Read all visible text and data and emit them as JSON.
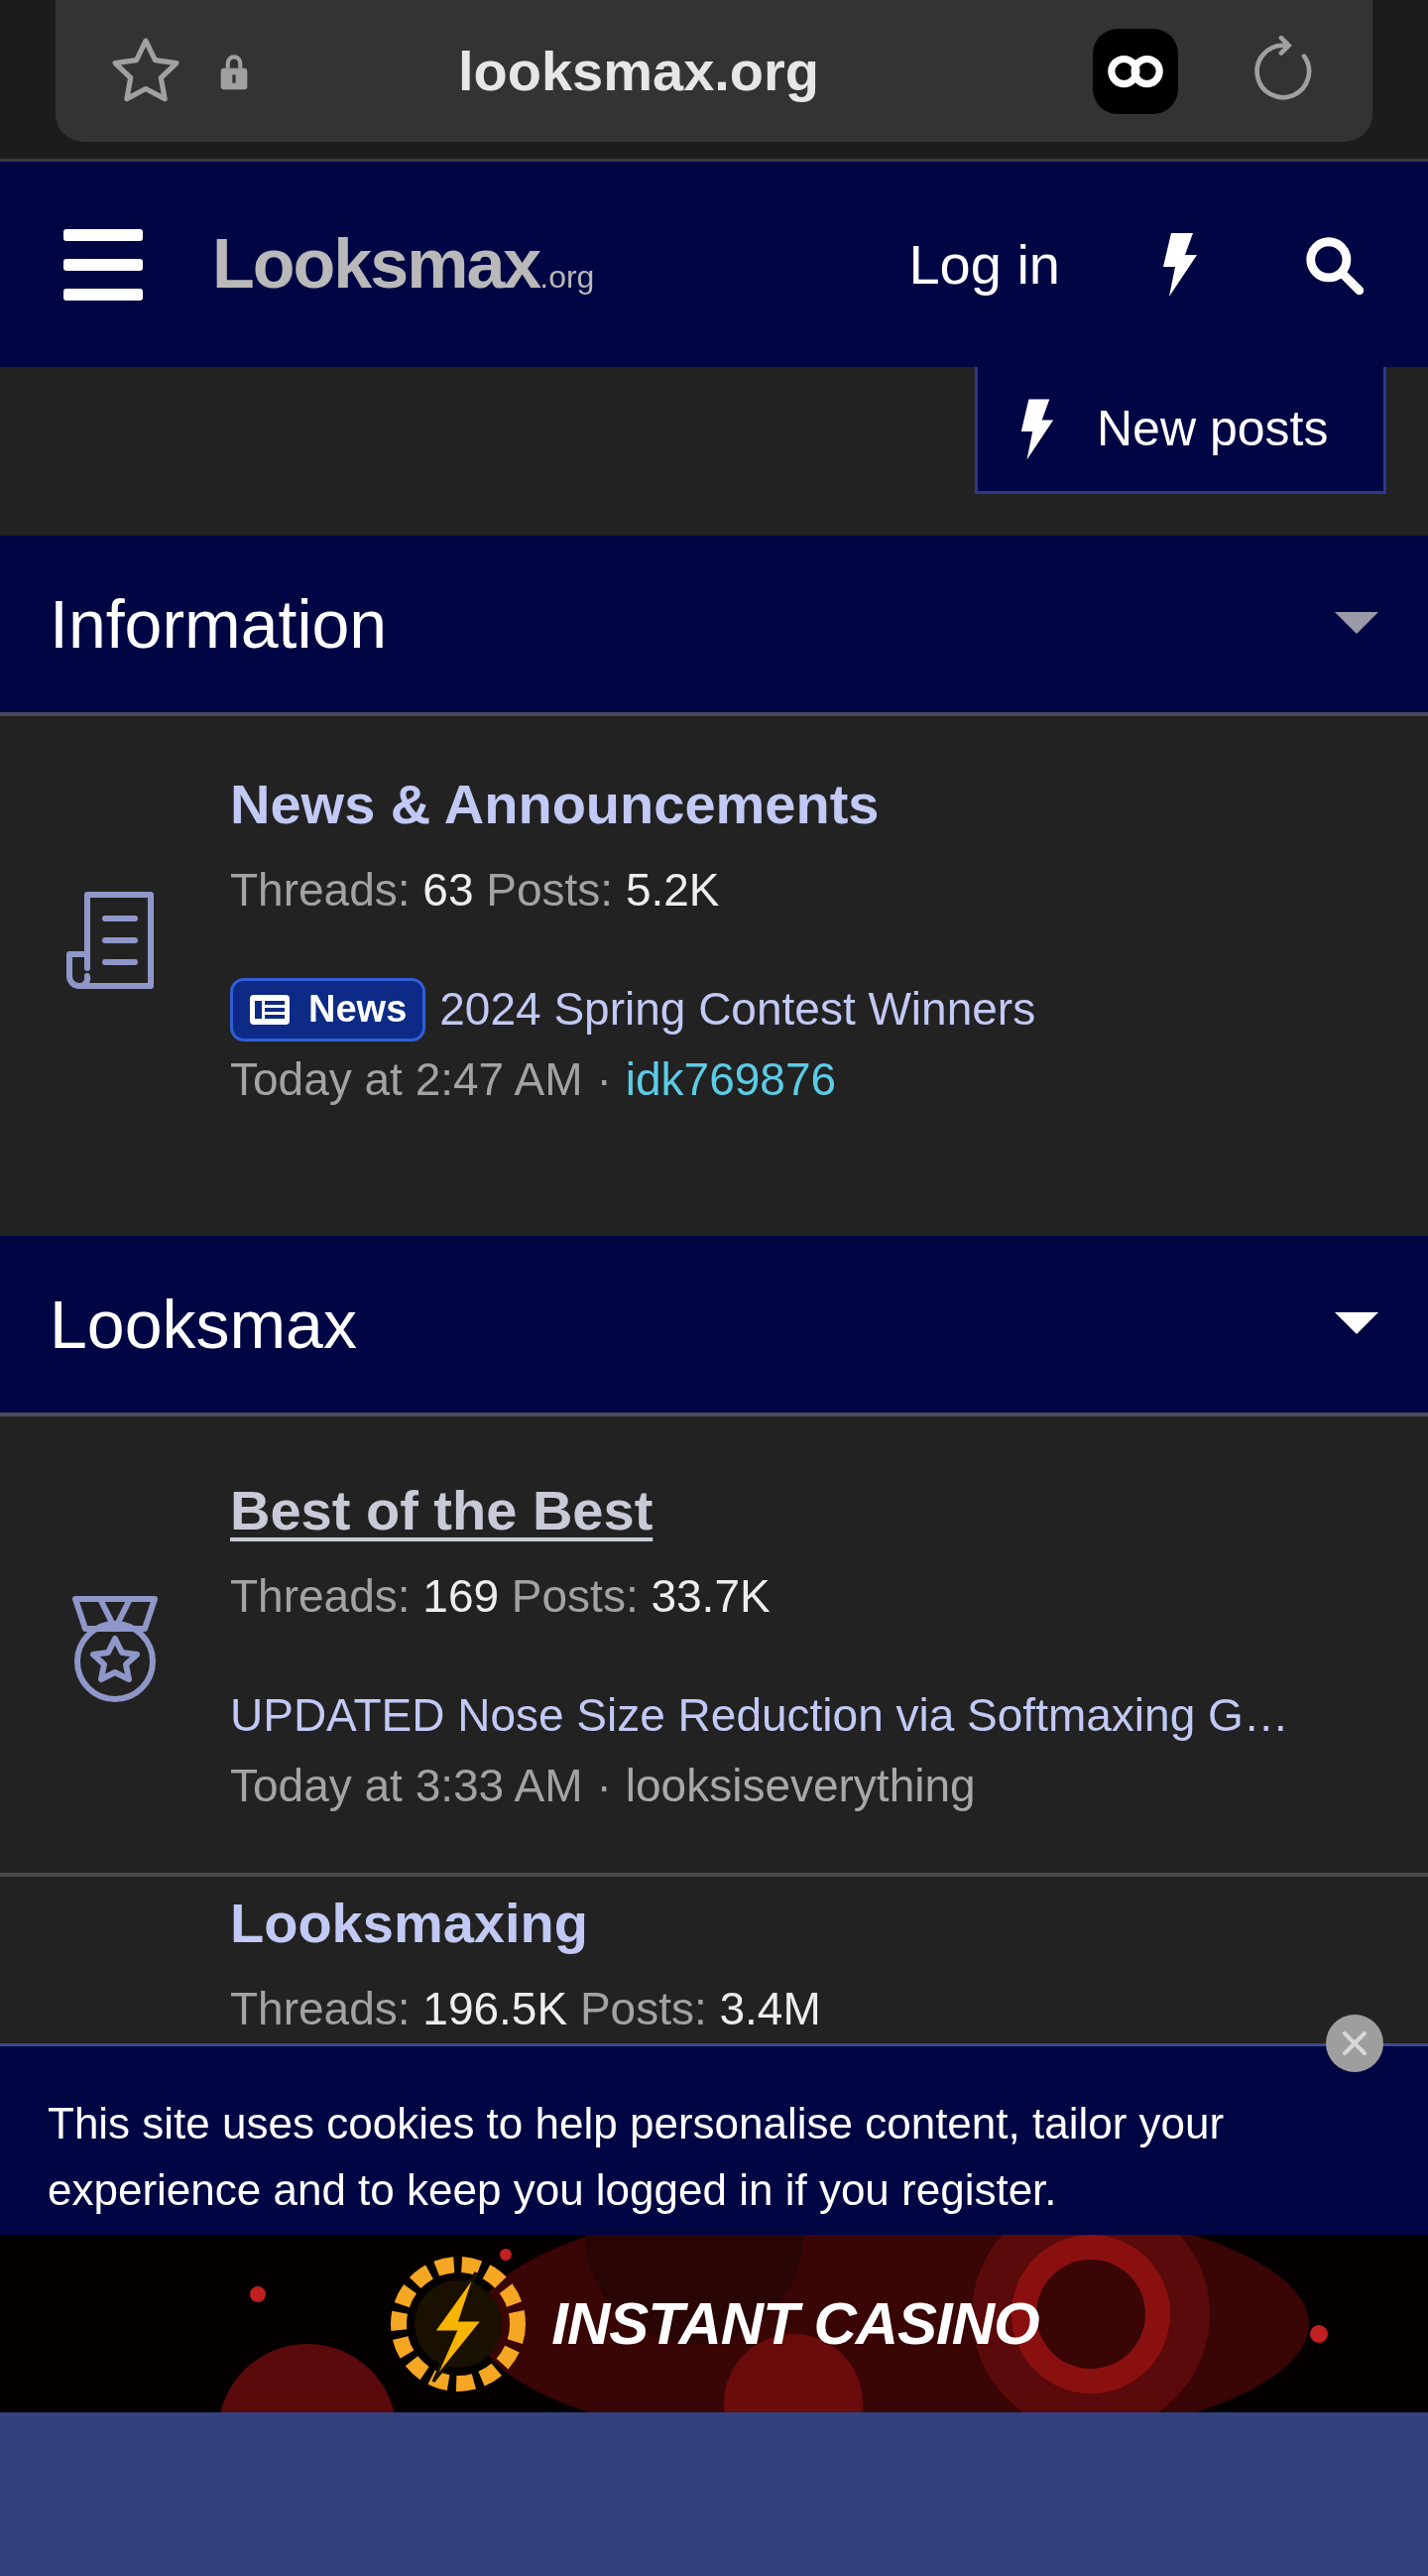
{
  "browser": {
    "url": "looksmax.org"
  },
  "header": {
    "logo_text": "Looksmax",
    "logo_suffix": ".org",
    "login": "Log in"
  },
  "new_posts_button": {
    "label": "New posts"
  },
  "categories": [
    {
      "title": "Information",
      "expanded": true,
      "nodes": [
        {
          "kind": "document",
          "title": "News & Announcements",
          "hovered": false,
          "threads_label": "Threads:",
          "threads": "63",
          "posts_label": "Posts:",
          "posts": "5.2K",
          "latest": {
            "prefix": "News",
            "title": "2024 Spring Contest Winners",
            "time": "Today at 2:47 AM",
            "separator": "·",
            "author": "idk769876",
            "author_highlighted": true
          }
        }
      ]
    },
    {
      "title": "Looksmax",
      "expanded": true,
      "nodes": [
        {
          "kind": "medal",
          "title": "Best of the Best",
          "hovered": true,
          "threads_label": "Threads:",
          "threads": "169",
          "posts_label": "Posts:",
          "posts": "33.7K",
          "latest": {
            "title": "UPDATED Nose Size Reduction via Softmaxing G…",
            "time": "Today at 3:33 AM",
            "separator": "·",
            "author": "looksiseverything",
            "author_highlighted": false
          }
        },
        {
          "title": "Looksmaxing",
          "hovered": false,
          "threads_label": "Threads:",
          "threads": "196.5K",
          "posts_label": "Posts:",
          "posts": "3.4M"
        }
      ]
    }
  ],
  "cookie_notice": {
    "text": "This site uses cookies to help personalise content, tailor your experience and to keep you logged in if you register."
  },
  "ad_banner": {
    "kind": "picture",
    "brand": "INSTANT CASINO"
  }
}
